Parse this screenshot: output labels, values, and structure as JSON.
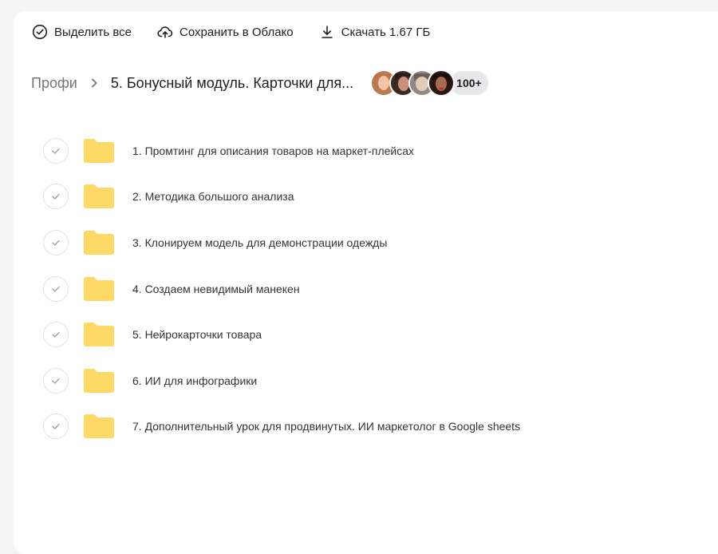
{
  "toolbar": {
    "select_all": "Выделить все",
    "save_cloud": "Сохранить в Облако",
    "download": "Скачать 1.67 ГБ"
  },
  "breadcrumb": {
    "root": "Профи",
    "current": "5. Бонусный модуль. Карточки для..."
  },
  "participants": {
    "more_label": "100+"
  },
  "items": [
    {
      "label": "1. Промтинг для описания товаров на маркет-плейсах"
    },
    {
      "label": "2. Методика большого анализа"
    },
    {
      "label": "3. Клонируем модель для демонстрации одежды"
    },
    {
      "label": "4. Создаем невидимый манекен"
    },
    {
      "label": "5. Нейрокарточки товара"
    },
    {
      "label": "6. ИИ для инфографики"
    },
    {
      "label": "7. Дополнительный урок для продвинутых. ИИ маркетолог в Google sheets"
    }
  ],
  "colors": {
    "folder": "#ffd966",
    "folder_tab": "#f7cf5a",
    "panel": "#ffffff",
    "background": "#f4f4f5"
  },
  "icons": {
    "select_all": "check-circle-icon",
    "save_cloud": "cloud-upload-icon",
    "download": "download-icon",
    "separator": "chevron-right-icon",
    "item": "folder-icon",
    "item_check": "check-icon"
  }
}
